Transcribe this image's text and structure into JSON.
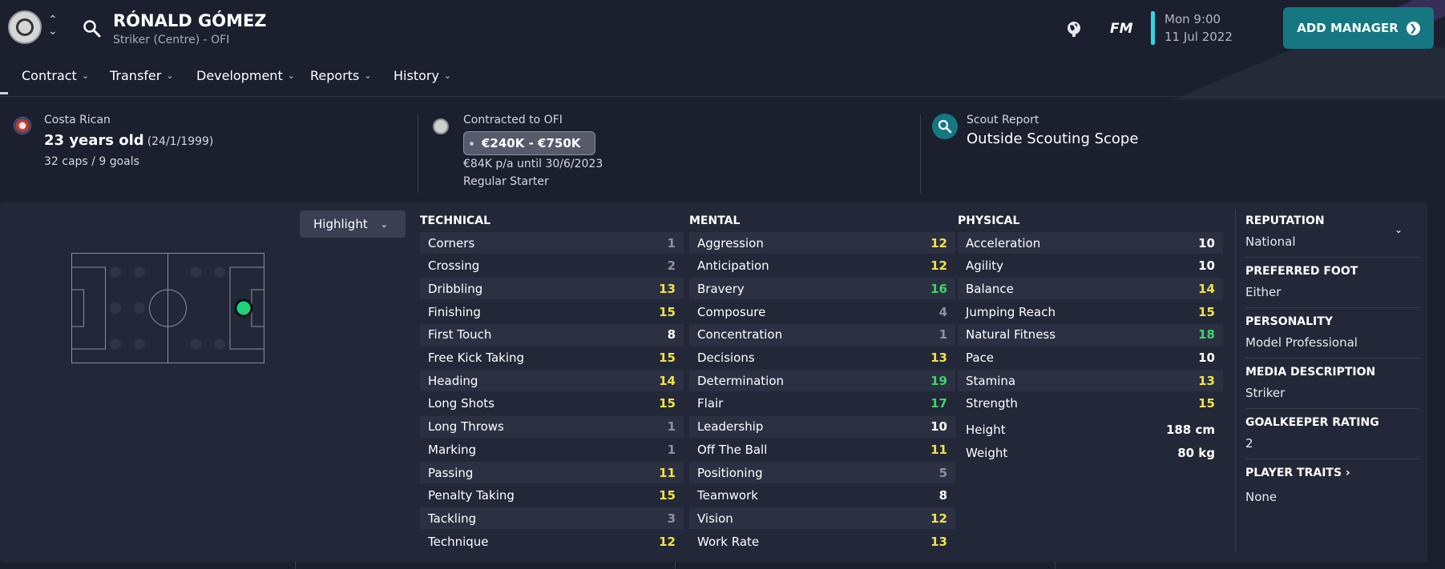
{
  "header": {
    "player_name": "RÓNALD GÓMEZ",
    "player_subtitle": "Striker (Centre) - OFI",
    "brand": "FM",
    "date_line1": "Mon 9:00",
    "date_line2": "11 Jul 2022",
    "add_manager_label": "ADD MANAGER"
  },
  "menu": [
    "Contract",
    "Transfer",
    "Development",
    "Reports",
    "History"
  ],
  "info": {
    "nationality": "Costa Rican",
    "age": "23 years old",
    "dob": "(24/1/1999)",
    "caps_goals": "32 caps / 9 goals",
    "contracted_to": "Contracted to OFI",
    "value_range": "€240K - €750K",
    "wage": "€84K p/a until 30/6/2023",
    "squad_status": "Regular Starter",
    "scout_label": "Scout Report",
    "scout_value": "Outside Scouting Scope"
  },
  "highlight_label": "Highlight",
  "attributes": {
    "technical_title": "TECHNICAL",
    "mental_title": "MENTAL",
    "physical_title": "PHYSICAL",
    "technical": [
      {
        "name": "Corners",
        "value": "1"
      },
      {
        "name": "Crossing",
        "value": "2"
      },
      {
        "name": "Dribbling",
        "value": "13"
      },
      {
        "name": "Finishing",
        "value": "15"
      },
      {
        "name": "First Touch",
        "value": "8"
      },
      {
        "name": "Free Kick Taking",
        "value": "15"
      },
      {
        "name": "Heading",
        "value": "14"
      },
      {
        "name": "Long Shots",
        "value": "15"
      },
      {
        "name": "Long Throws",
        "value": "1"
      },
      {
        "name": "Marking",
        "value": "1"
      },
      {
        "name": "Passing",
        "value": "11"
      },
      {
        "name": "Penalty Taking",
        "value": "15"
      },
      {
        "name": "Tackling",
        "value": "3"
      },
      {
        "name": "Technique",
        "value": "12"
      }
    ],
    "mental": [
      {
        "name": "Aggression",
        "value": "12"
      },
      {
        "name": "Anticipation",
        "value": "12"
      },
      {
        "name": "Bravery",
        "value": "16"
      },
      {
        "name": "Composure",
        "value": "4"
      },
      {
        "name": "Concentration",
        "value": "1"
      },
      {
        "name": "Decisions",
        "value": "13"
      },
      {
        "name": "Determination",
        "value": "19"
      },
      {
        "name": "Flair",
        "value": "17"
      },
      {
        "name": "Leadership",
        "value": "10"
      },
      {
        "name": "Off The Ball",
        "value": "11"
      },
      {
        "name": "Positioning",
        "value": "5"
      },
      {
        "name": "Teamwork",
        "value": "8"
      },
      {
        "name": "Vision",
        "value": "12"
      },
      {
        "name": "Work Rate",
        "value": "13"
      }
    ],
    "physical": [
      {
        "name": "Acceleration",
        "value": "10"
      },
      {
        "name": "Agility",
        "value": "10"
      },
      {
        "name": "Balance",
        "value": "14"
      },
      {
        "name": "Jumping Reach",
        "value": "15"
      },
      {
        "name": "Natural Fitness",
        "value": "18"
      },
      {
        "name": "Pace",
        "value": "10"
      },
      {
        "name": "Stamina",
        "value": "13"
      },
      {
        "name": "Strength",
        "value": "15"
      },
      {
        "name": "Height",
        "value": "188 cm"
      },
      {
        "name": "Weight",
        "value": "80 kg"
      }
    ]
  },
  "side": {
    "reputation_label": "REPUTATION",
    "reputation_value": "National",
    "foot_label": "PREFERRED FOOT",
    "foot_value": "Either",
    "personality_label": "PERSONALITY",
    "personality_value": "Model Professional",
    "media_label": "MEDIA DESCRIPTION",
    "media_value": "Striker",
    "gk_label": "GOALKEEPER RATING",
    "gk_value": "2",
    "traits_label": "PLAYER TRAITS",
    "traits_value": "None"
  },
  "colors": {
    "accent_teal": "#157782",
    "highlight_cyan": "#2fd6e6",
    "value_yellow": "#f3e34a",
    "value_green": "#3fd46a",
    "value_grey": "#8e92a0",
    "position_dot": "#1fd27a"
  }
}
